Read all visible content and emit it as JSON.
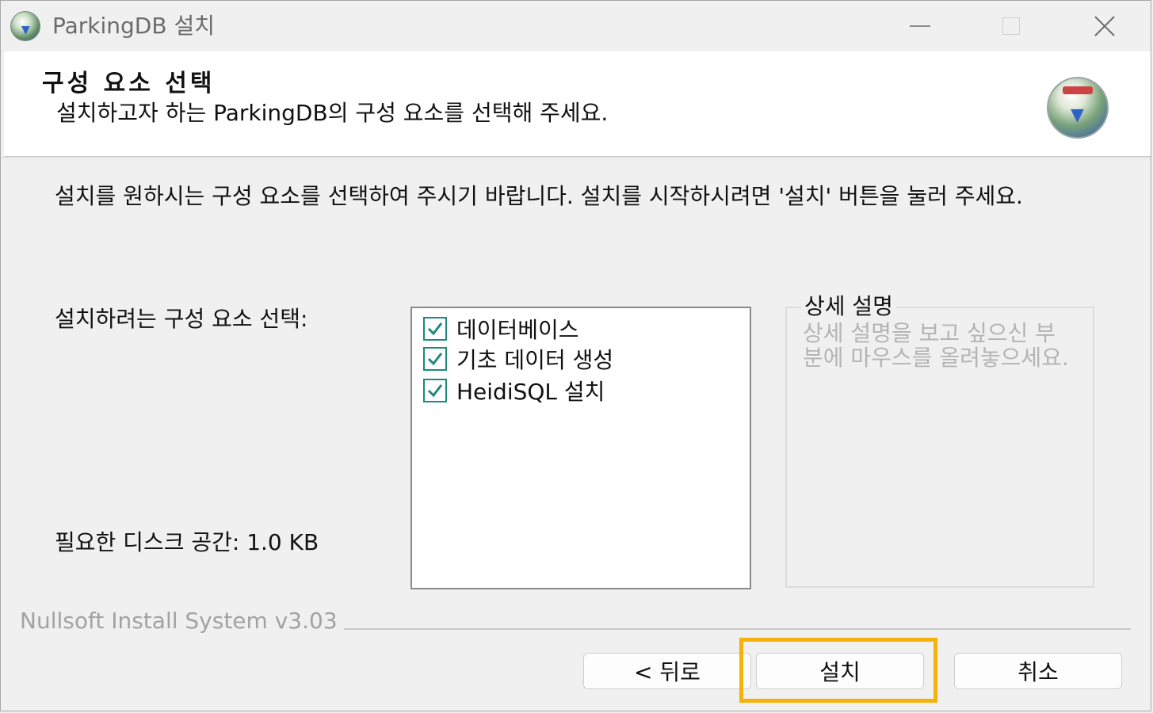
{
  "window": {
    "title": "ParkingDB 설치"
  },
  "header": {
    "title": "구성 요소 선택",
    "subtitle": "설치하고자 하는 ParkingDB의 구성 요소를 선택해 주세요."
  },
  "body": {
    "intro": "설치를 원하시는 구성 요소를 선택하여 주시기 바랍니다. 설치를 시작하시려면 '설치' 버튼을 눌러 주세요.",
    "select_label": "설치하려는 구성 요소 선택:",
    "disk_space": "필요한 디스크 공간: 1.0 KB",
    "components": [
      {
        "label": "데이터베이스",
        "checked": true
      },
      {
        "label": "기초 데이터 생성",
        "checked": true
      },
      {
        "label": "HeidiSQL 설치",
        "checked": true
      }
    ],
    "description": {
      "title": "상세 설명",
      "text": "상세 설명을 보고 싶으신 부분에 마우스를 올려놓으세요."
    }
  },
  "footer": {
    "branding": "Nullsoft Install System v3.03",
    "back_label": "< 뒤로",
    "install_label": "설치",
    "cancel_label": "취소"
  },
  "colors": {
    "highlight": "#f6b20c",
    "checkbox": "#1c8a7e"
  }
}
